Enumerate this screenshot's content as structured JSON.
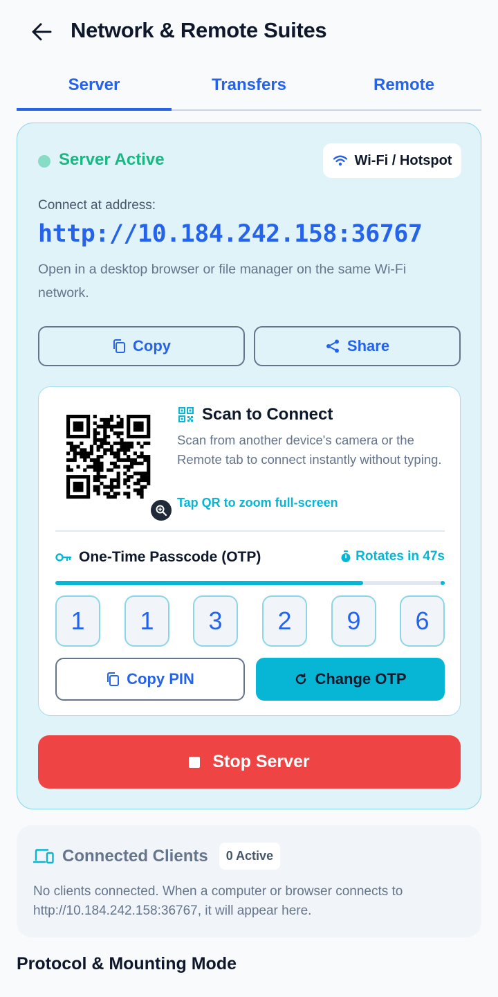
{
  "header": {
    "title": "Network & Remote Suites"
  },
  "tabs": [
    {
      "label": "Server",
      "active": true
    },
    {
      "label": "Transfers",
      "active": false
    },
    {
      "label": "Remote",
      "active": false
    }
  ],
  "server": {
    "status": "Server Active",
    "network_chip": "Wi-Fi / Hotspot",
    "address_label": "Connect at address:",
    "address": "http://10.184.242.158:36767",
    "hint": "Open in a desktop browser or file manager on the same Wi-Fi network.",
    "copy_label": "Copy",
    "share_label": "Share",
    "stop_label": "Stop Server"
  },
  "qr": {
    "title": "Scan to Connect",
    "description": "Scan from another device's camera or the Remote tab to connect instantly without typing.",
    "zoom_hint": "Tap QR to zoom full-screen"
  },
  "otp": {
    "title": "One-Time Passcode (OTP)",
    "rotates": "Rotates in 47s",
    "progress": 0.79,
    "digits": [
      "1",
      "1",
      "3",
      "2",
      "9",
      "6"
    ],
    "copy_pin_label": "Copy PIN",
    "change_label": "Change OTP"
  },
  "clients": {
    "title": "Connected Clients",
    "badge": "0 Active",
    "text": "No clients connected. When a computer or browser connects to http://10.184.242.158:36767, it will appear here."
  },
  "section_heading": "Protocol & Mounting Mode",
  "colors": {
    "accent": "#2563eb",
    "cyan": "#06b6d4",
    "success": "#16b981",
    "danger": "#ef4444"
  }
}
